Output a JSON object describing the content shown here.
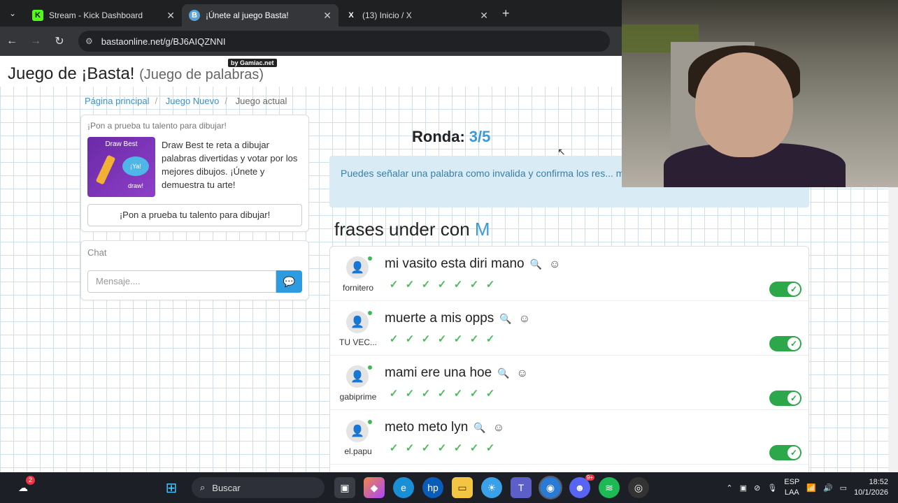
{
  "browser": {
    "tabs": [
      {
        "title": "Stream - Kick Dashboard",
        "favicon": "K",
        "active": false
      },
      {
        "title": "¡Únete al juego Basta!",
        "favicon": "B",
        "active": true
      },
      {
        "title": "(13) Inicio / X",
        "favicon": "X",
        "active": false
      }
    ],
    "url": "bastaonline.net/g/BJ6AIQZNNI"
  },
  "page": {
    "title": "Juego de ¡Basta!",
    "subtitle": "(Juego de palabras)",
    "byline": "by Gamiac.net",
    "breadcrumbs": [
      "Página principal",
      "Juego Nuevo",
      "Juego actual"
    ],
    "promo": {
      "heading": "¡Pon a prueba tu talento para dibujar!",
      "image_title": "Draw Best",
      "image_bubble": "¡Ya! draw!",
      "text": "Draw Best te reta a dibujar palabras divertidas y votar por los mejores dibujos. ¡Únete y demuestra tu arte!",
      "button": "¡Pon a prueba tu talento para dibujar!"
    },
    "chat": {
      "heading": "Chat",
      "placeholder": "Mensaje...."
    },
    "round": {
      "label": "Ronda:",
      "value": "3/5"
    },
    "info": "Puedes señalar una palabra como invalida y confirma los res... más abajo.",
    "category": {
      "text": "frases under con",
      "letter": "M"
    },
    "answers": [
      {
        "user": "fornitero",
        "phrase": "mi vasito esta diri mano",
        "checks": 7,
        "valid": true
      },
      {
        "user": "TU VEC...",
        "phrase": "muerte a mis opps",
        "checks": 7,
        "valid": true
      },
      {
        "user": "gabiprime",
        "phrase": "mami ere una hoe",
        "checks": 7,
        "valid": true
      },
      {
        "user": "el.papu",
        "phrase": "meto meto lyn",
        "checks": 7,
        "valid": true
      }
    ]
  },
  "taskbar": {
    "search": "Buscar",
    "notification_badge": "2",
    "discord_badge": "9+",
    "language": [
      "ESP",
      "LAA"
    ],
    "time": "18:52",
    "date": "10/1/2026"
  },
  "colors": {
    "accent": "#3a9ad9",
    "toggle_on": "#2ca84a",
    "check": "#4cbb5a"
  }
}
